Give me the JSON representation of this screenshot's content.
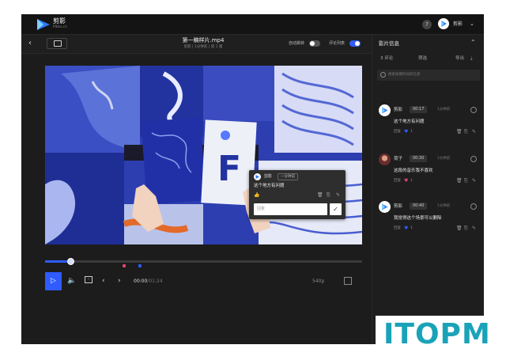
{
  "app": {
    "brand": "剪影",
    "brand_sub": "Piktu.cn",
    "user_name": "剪影"
  },
  "player_header": {
    "file_name": "第一稿样片.mp4",
    "file_meta": "剪影 | 1分钟前 | 第 1 版",
    "auto_jump_label": "自动跳转",
    "comment_list_label": "评论列表",
    "auto_jump_on": false,
    "comment_list_on": true
  },
  "player": {
    "current_time": "00:00",
    "total_time": "01:24",
    "quality": "540p",
    "progress": 0.08,
    "accent": "#2f5bff",
    "marker_colors": [
      "#e0436b",
      "#2f5bff"
    ]
  },
  "popup": {
    "user": "剪影",
    "time_tag": "一分钟前",
    "text": "这个地方有问题",
    "input_placeholder": "回复"
  },
  "panel": {
    "title": "影片信息",
    "comment_count": "3 评论",
    "sort_label": "筛选",
    "export_label": "导出",
    "search_placeholder": "搜索按键时间的信息",
    "comments": [
      {
        "user": "剪影",
        "time": "00:17",
        "ago": "1分钟前",
        "text": "这个地方有问题",
        "reply": "回复",
        "likes": "1",
        "avatar": "logo",
        "like_color": "blue"
      },
      {
        "user": "荷子",
        "time": "00:30",
        "ago": "1分钟前",
        "text": "这段的音乐我不喜欢",
        "reply": "回复",
        "likes": "1",
        "avatar": "photo",
        "like_color": "red"
      },
      {
        "user": "剪影",
        "time": "00:40",
        "ago": "1分钟前",
        "text": "我觉得这个场景可以删除",
        "reply": "回复",
        "likes": "1",
        "avatar": "logo",
        "like_color": "blue"
      }
    ]
  },
  "watermark": {
    "text": "ITOPM"
  }
}
